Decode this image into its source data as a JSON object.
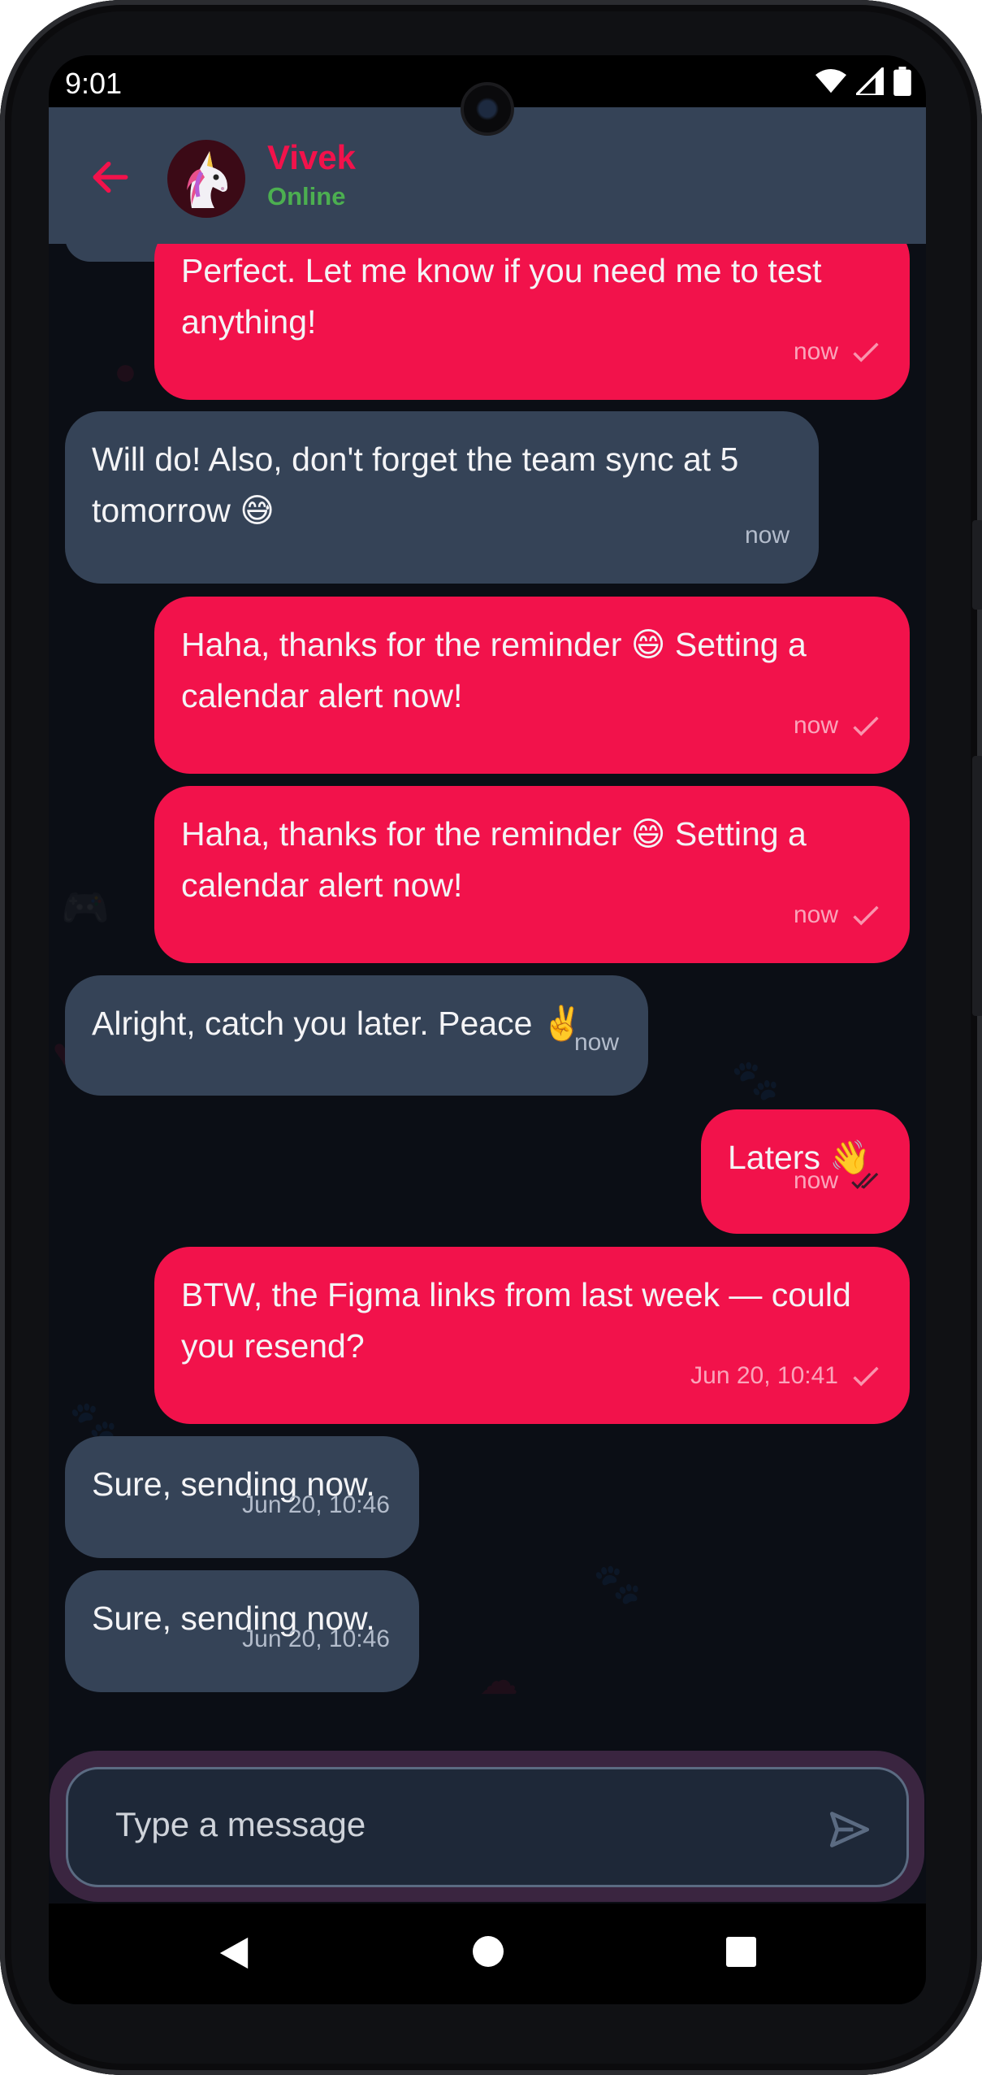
{
  "status_bar": {
    "time": "9:01"
  },
  "header": {
    "contact_name": "Vivek",
    "contact_status": "Online",
    "avatar_emoji": "🦄",
    "accent_color": "#f2124b"
  },
  "messages": [
    {
      "direction": "out",
      "text": "Perfect. Let me know if you need me to test anything!",
      "time": "now",
      "status": "sent"
    },
    {
      "direction": "in",
      "text": "Will do! Also, don't forget the team sync at 5 tomorrow 😅",
      "time": "now"
    },
    {
      "direction": "out",
      "text": "Haha, thanks for the reminder 😄 Setting a calendar alert now!",
      "time": "now",
      "status": "sent"
    },
    {
      "direction": "out",
      "text": "Haha, thanks for the reminder 😄 Setting a calendar alert now!",
      "time": "now",
      "status": "sent"
    },
    {
      "direction": "in",
      "text": "Alright, catch you later. Peace ✌️",
      "time": "now"
    },
    {
      "direction": "out",
      "text": "Laters 👋",
      "time": "now",
      "status": "read"
    },
    {
      "direction": "out",
      "text": "BTW, the Figma links from last week — could you resend?",
      "time": "Jun 20, 10:41",
      "status": "sent"
    },
    {
      "direction": "in",
      "text": "Sure, sending now.",
      "time": "Jun 20, 10:46"
    },
    {
      "direction": "in",
      "text": "Sure, sending now.",
      "time": "Jun 20, 10:46"
    }
  ],
  "composer": {
    "placeholder": "Type a message"
  }
}
